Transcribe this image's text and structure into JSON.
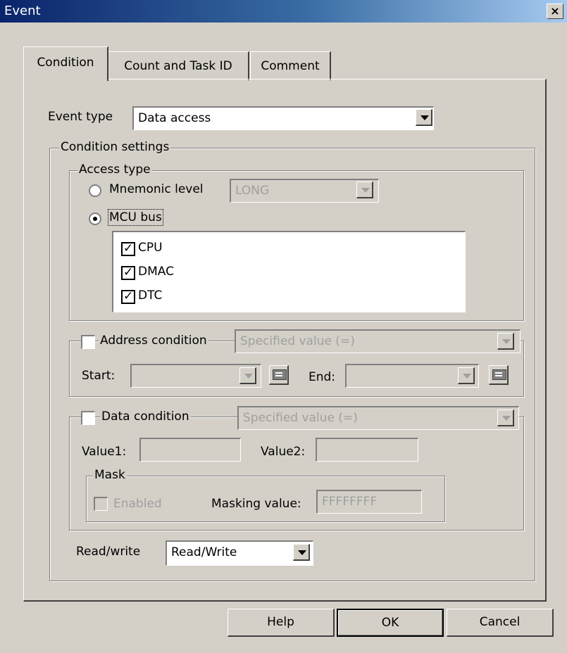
{
  "window": {
    "title": "Event"
  },
  "tabs": [
    {
      "label": "Condition",
      "active": true
    },
    {
      "label": "Count and Task ID",
      "active": false
    },
    {
      "label": "Comment",
      "active": false
    }
  ],
  "event_type": {
    "label": "Event type",
    "value": "Data access"
  },
  "condition_settings": {
    "label": "Condition settings",
    "access_type": {
      "label": "Access type",
      "mnemonic_level": {
        "label": "Mnemonic level",
        "checked": false,
        "value": "LONG"
      },
      "mcu_bus": {
        "label": "MCU bus",
        "checked": true,
        "items": [
          {
            "label": "CPU",
            "checked": true
          },
          {
            "label": "DMAC",
            "checked": true
          },
          {
            "label": "DTC",
            "checked": true
          }
        ]
      }
    },
    "address_condition": {
      "label": "Address condition",
      "checked": false,
      "mode": "Specified value (=)",
      "start_label": "Start:",
      "start_value": "",
      "end_label": "End:",
      "end_value": ""
    },
    "data_condition": {
      "label": "Data condition",
      "checked": false,
      "mode": "Specified value (=)",
      "value1_label": "Value1:",
      "value1": "",
      "value2_label": "Value2:",
      "value2": "",
      "mask": {
        "label": "Mask",
        "enabled_label": "Enabled",
        "enabled_checked": false,
        "masking_label": "Masking value:",
        "masking_value": "FFFFFFFF"
      }
    },
    "read_write": {
      "label": "Read/write",
      "value": "Read/Write"
    }
  },
  "buttons": {
    "help": "Help",
    "ok": "OK",
    "cancel": "Cancel"
  },
  "colors": {
    "face": "#d4d0c8",
    "title_start": "#0a246a",
    "title_end": "#a6caf0",
    "disabled_text": "#a0a0a0"
  },
  "icons": {
    "close": "×"
  }
}
